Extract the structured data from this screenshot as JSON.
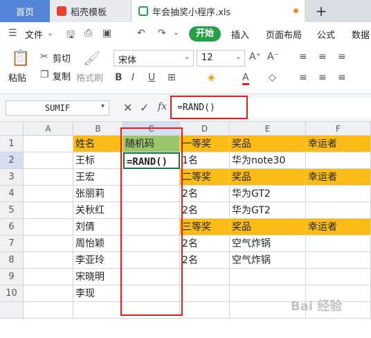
{
  "tabs": {
    "home": "首页",
    "docer": "稻壳模板",
    "file": "年会抽奖小程序.xls"
  },
  "menu": {
    "file": "文件",
    "start": "开始",
    "insert": "插入",
    "layout": "页面布局",
    "formula": "公式",
    "data": "数据"
  },
  "toolbar": {
    "paste": "粘贴",
    "cut": "剪切",
    "copy": "复制",
    "format_painter": "格式刷",
    "font_name": "宋体",
    "font_size": "12"
  },
  "formula_bar": {
    "name_box": "SUMIF",
    "fx": "fx",
    "formula": "=RAND()"
  },
  "columns": [
    "A",
    "B",
    "C",
    "D",
    "E",
    "F"
  ],
  "rows": [
    "1",
    "2",
    "3",
    "4",
    "5",
    "6",
    "7",
    "8",
    "9",
    "10"
  ],
  "cells": {
    "B1": "姓名",
    "C1": "随机码",
    "D1": "一等奖",
    "E1": "奖品",
    "F1": "幸运者",
    "B2": "王标",
    "C2": "=RAND()",
    "D2": "1名",
    "E2": "华为note30",
    "B3": "王宏",
    "D3": "二等奖",
    "E3": "奖品",
    "F3": "幸运者",
    "B4": "张丽莉",
    "D4": "2名",
    "E4": "华为GT2",
    "B5": "关秋红",
    "D5": "2名",
    "E5": "华为GT2",
    "B6": "刘倩",
    "D6": "三等奖",
    "E6": "奖品",
    "F6": "幸运者",
    "B7": "周怡颖",
    "D7": "2名",
    "E7": "空气炸锅",
    "B8": "李亚玲",
    "D8": "2名",
    "E8": "空气炸锅",
    "B9": "宋晓明",
    "B10": "李现"
  },
  "watermark": "Bai 经验",
  "colors": {
    "header_yellow": "#fbbd15",
    "header_green": "#99c66b",
    "accent_red": "#e02020",
    "start_green": "#26a146"
  }
}
